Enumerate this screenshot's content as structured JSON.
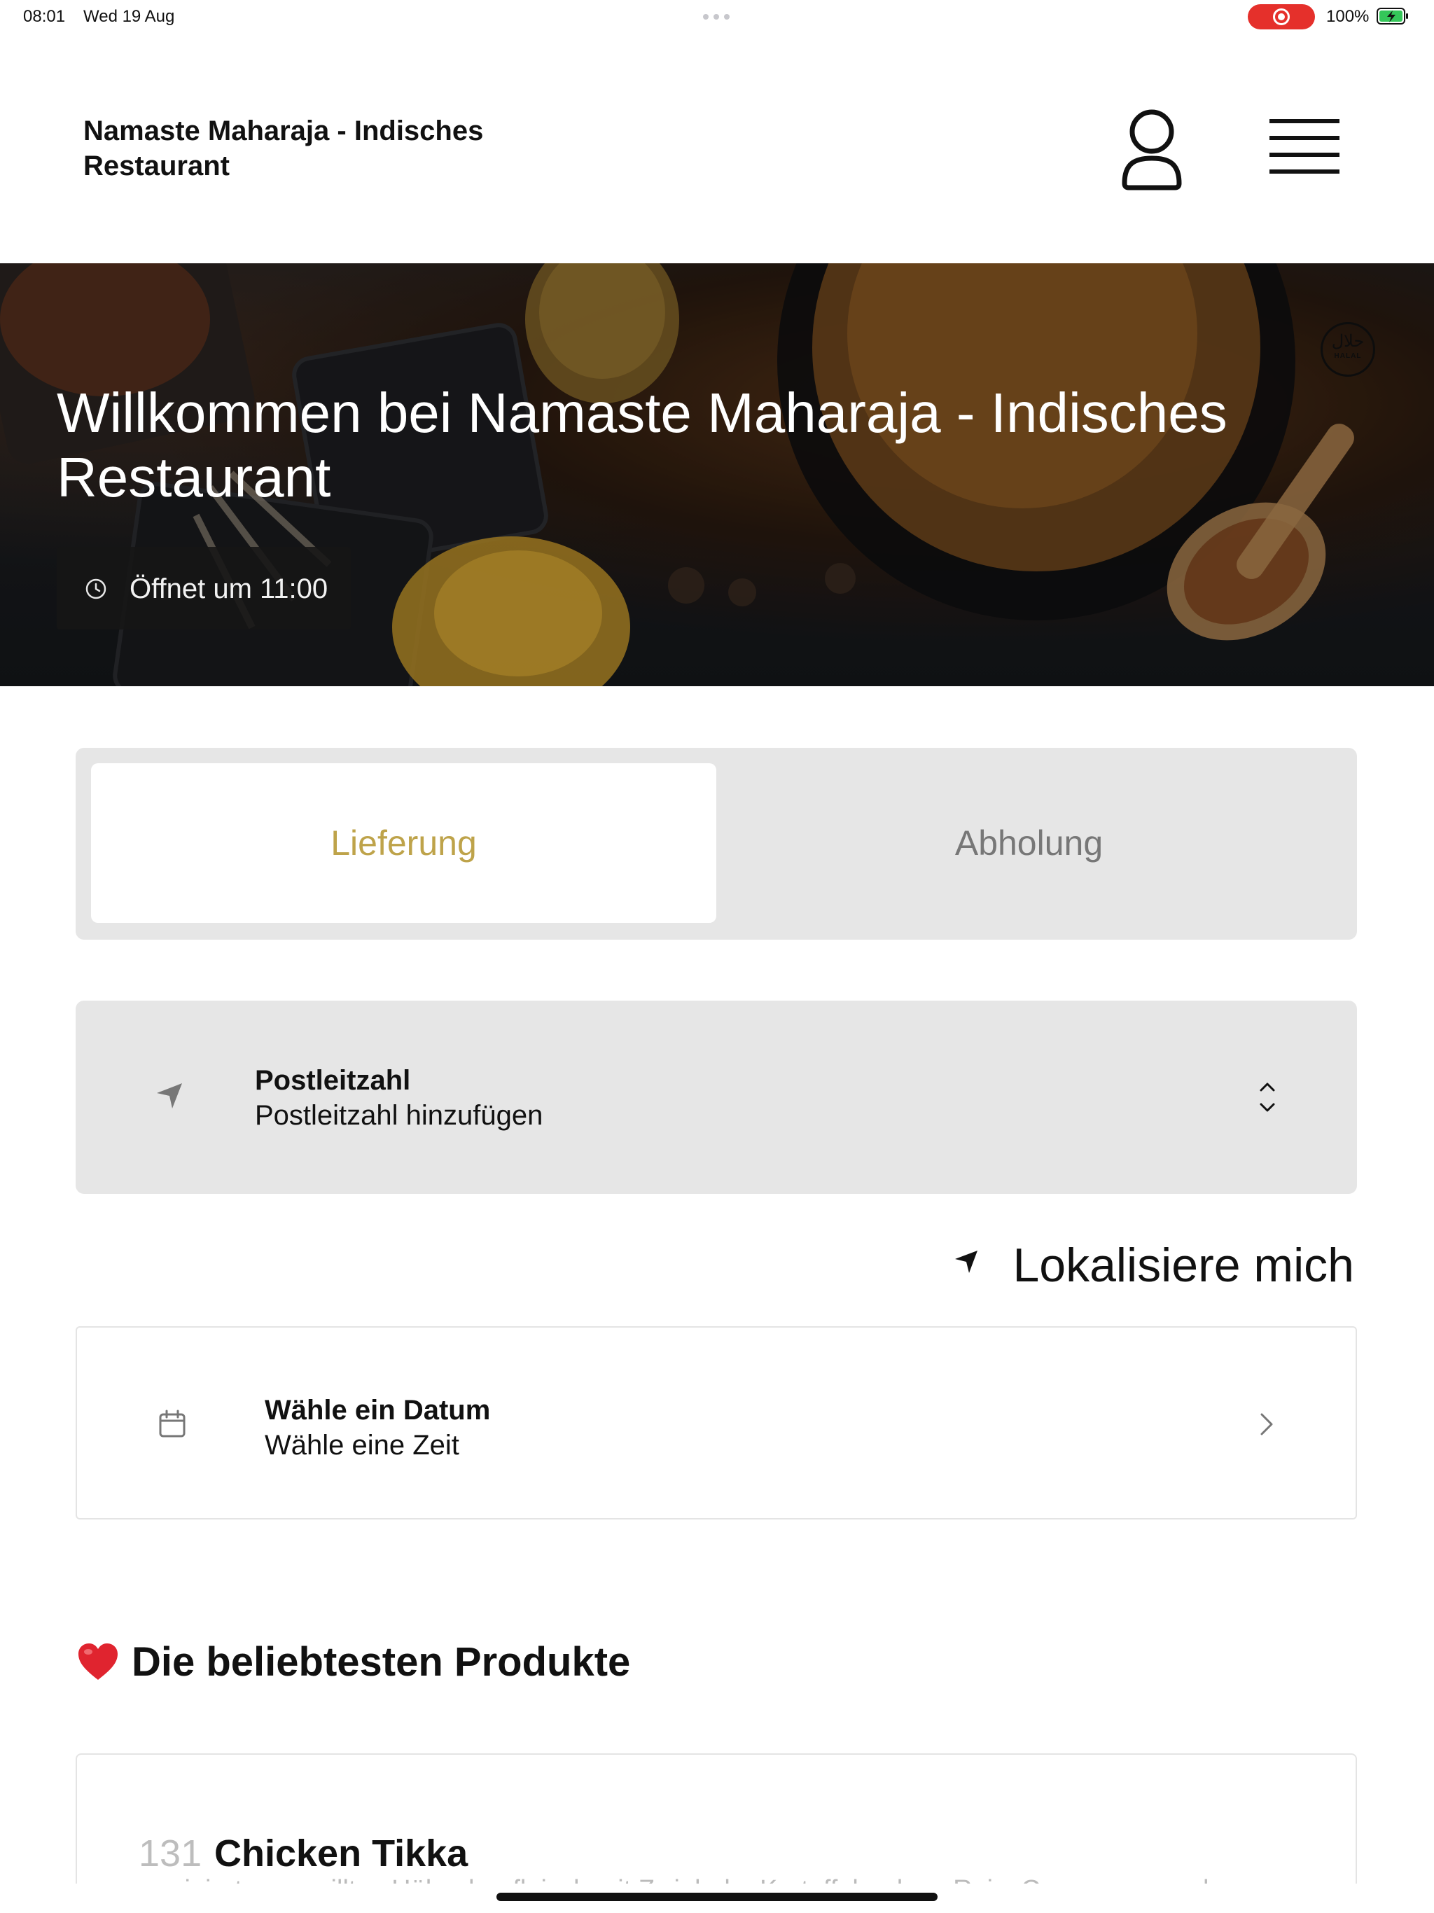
{
  "status_bar": {
    "time": "08:01",
    "date": "Wed 19 Aug",
    "battery": "100%"
  },
  "header": {
    "restaurant_name": "Namaste Maharaja - Indisches Restaurant",
    "icons": [
      "user-icon",
      "menu-icon"
    ]
  },
  "hero": {
    "welcome": "Willkommen bei Namaste Maharaja - Indisches Restaurant",
    "opening": "Öffnet um 11:00",
    "halal_arabic": "حلال",
    "halal_latin": "HALAL"
  },
  "order_mode": {
    "options": [
      "Lieferung",
      "Abholung"
    ],
    "selected": "Lieferung",
    "accent_color": "#bea34a"
  },
  "postal": {
    "label": "Postleitzahl",
    "placeholder": "Postleitzahl hinzufügen"
  },
  "locate": {
    "label": "Lokalisiere mich"
  },
  "schedule": {
    "date_label": "Wähle ein Datum",
    "time_label": "Wähle eine Zeit"
  },
  "popular": {
    "title": "Die beliebtesten Produkte",
    "items": [
      {
        "number": "131",
        "name": "Chicken Tikka",
        "description": "mariniertes gegrilltes Hähnchenfleisch mit Zwiebeln, Kartoffeln, dazu Reis, Currysauce und"
      }
    ]
  }
}
